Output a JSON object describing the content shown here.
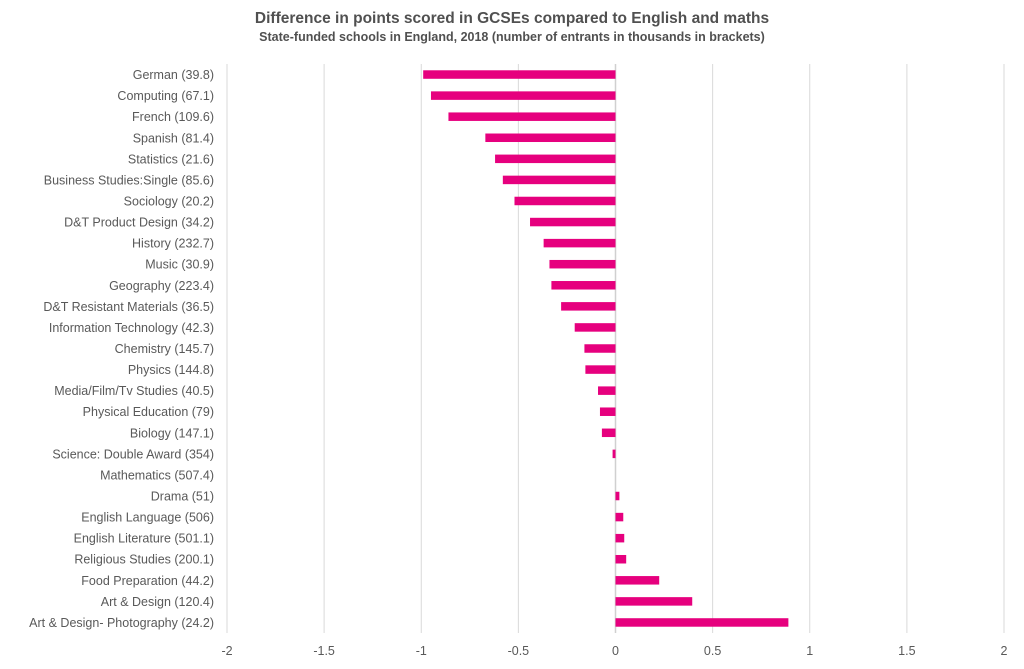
{
  "chart_data": {
    "type": "bar",
    "orientation": "horizontal",
    "title": "Difference in points scored in GCSEs compared to English and maths",
    "subtitle": "State-funded schools in England, 2018 (number of entrants in thousands in brackets)",
    "xlabel": "",
    "ylabel": "",
    "xlim": [
      -2,
      2
    ],
    "xticks": [
      -2,
      -1.5,
      -1,
      -0.5,
      0,
      0.5,
      1,
      1.5,
      2
    ],
    "xtick_labels": [
      "-2",
      "-1.5",
      "-1",
      "-0.5",
      "0",
      "0.5",
      "1",
      "1.5",
      "2"
    ],
    "grid": "vertical",
    "legend": "none",
    "bar_color": "#E6007E",
    "categories": [
      "German (39.8)",
      "Computing (67.1)",
      "French (109.6)",
      "Spanish (81.4)",
      "Statistics (21.6)",
      "Business Studies:Single (85.6)",
      "Sociology (20.2)",
      "D&T Product Design (34.2)",
      "History (232.7)",
      "Music (30.9)",
      "Geography (223.4)",
      "D&T Resistant Materials (36.5)",
      "Information Technology (42.3)",
      "Chemistry (145.7)",
      "Physics (144.8)",
      "Media/Film/Tv Studies (40.5)",
      "Physical Education (79)",
      "Biology (147.1)",
      "Science: Double Award (354)",
      "Mathematics (507.4)",
      "Drama (51)",
      "English Language (506)",
      "English Literature (501.1)",
      "Religious Studies (200.1)",
      "Food Preparation (44.2)",
      "Art & Design (120.4)",
      "Art & Design- Photography (24.2)"
    ],
    "values": [
      -0.99,
      -0.95,
      -0.86,
      -0.67,
      -0.62,
      -0.58,
      -0.52,
      -0.44,
      -0.37,
      -0.34,
      -0.33,
      -0.28,
      -0.21,
      -0.16,
      -0.155,
      -0.09,
      -0.08,
      -0.07,
      -0.015,
      0.0,
      0.02,
      0.04,
      0.045,
      0.055,
      0.225,
      0.395,
      0.89
    ]
  }
}
